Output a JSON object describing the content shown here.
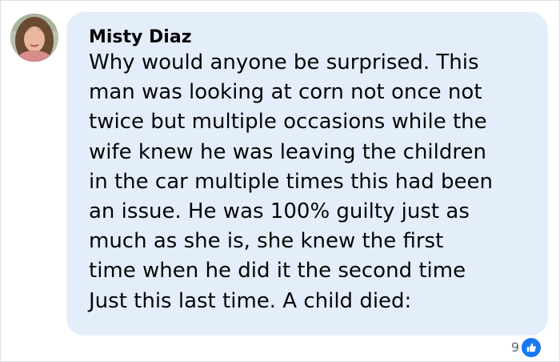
{
  "comment": {
    "author": "Misty Diaz",
    "body_lines": [
      "Why would anyone be surprised. This",
      "man was looking at corn not once not",
      "twice but multiple occasions while the",
      "wife knew he was leaving the children",
      "in the car multiple times this had been",
      "an issue. He was 100% guilty just as",
      "much as she is, she knew the first",
      "time when he did it the second time",
      "Just this last time. A child died:"
    ],
    "reactions": {
      "count": "9",
      "icon": "like-icon",
      "color": "#1877f2"
    }
  },
  "colors": {
    "bubble": "#e4eefb",
    "text": "#050505",
    "muted": "#65676b"
  }
}
